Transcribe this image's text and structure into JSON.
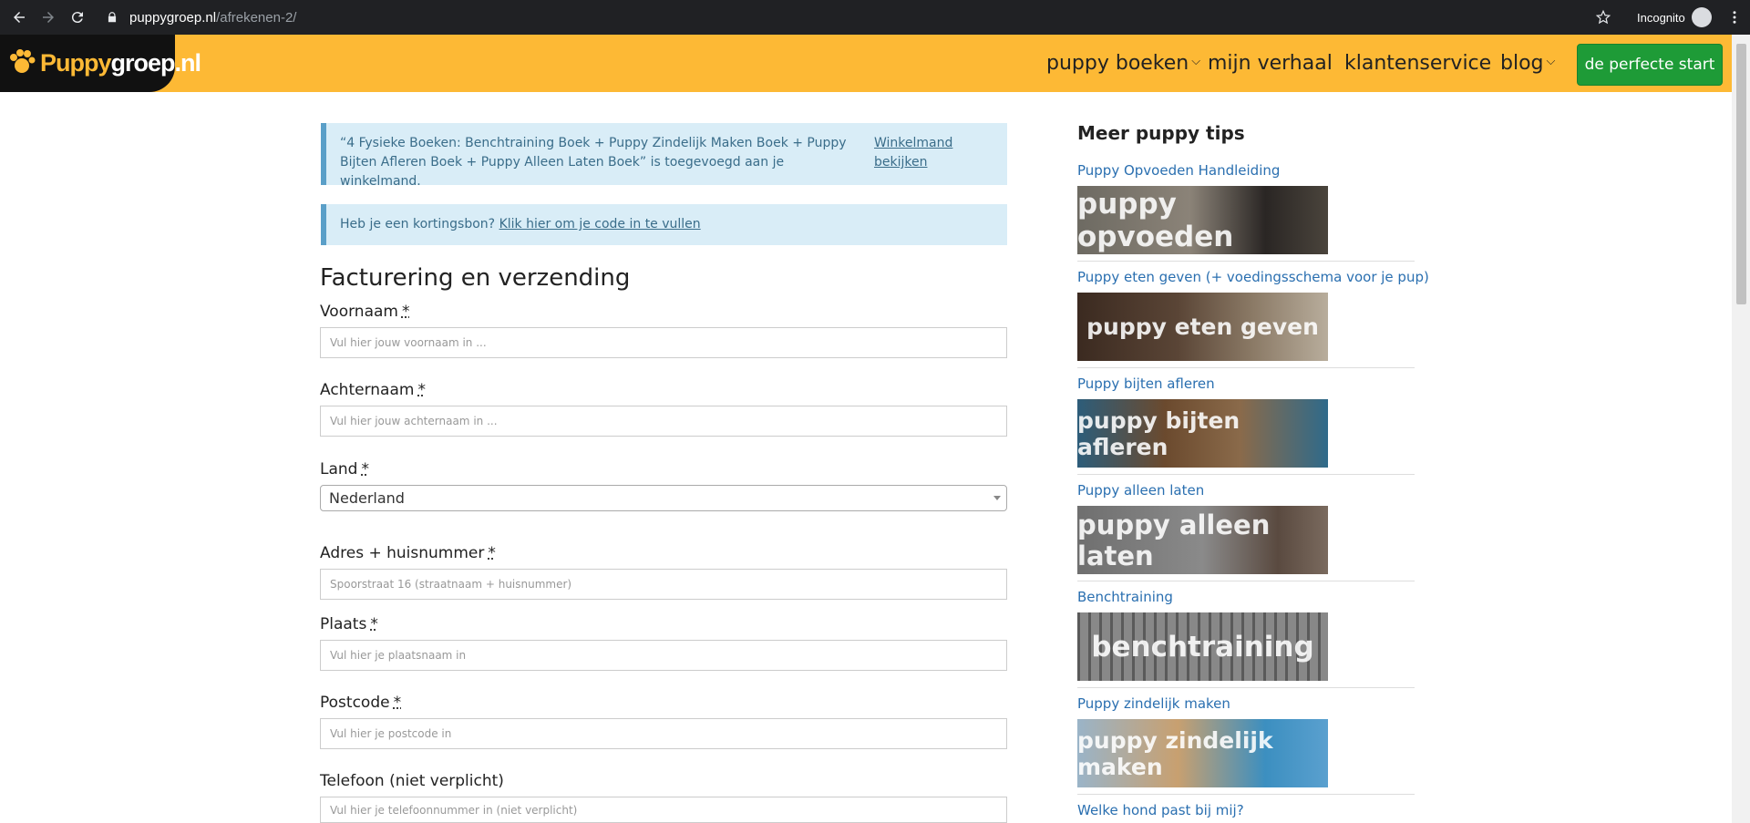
{
  "browser": {
    "url_host": "puppygroep.nl",
    "url_path": "/afrekenen-2/",
    "incognito_label": "Incognito"
  },
  "header": {
    "logo_part1": "Puppy",
    "logo_part2": "groep.nl",
    "nav": [
      "puppy boeken",
      "mijn verhaal",
      "klantenservice",
      "blog"
    ],
    "cta": "de perfecte start"
  },
  "notices": {
    "cart_message": "“4 Fysieke Boeken: Benchtraining Boek + Puppy Zindelijk Maken Boek + Puppy Bijten Afleren Boek + Puppy Alleen Laten Boek” is toegevoegd aan je winkelmand.",
    "cart_link": "Winkelmand bekijken",
    "coupon_text": "Heb je een kortingsbon?",
    "coupon_link": "Klik hier om je code in te vullen"
  },
  "form": {
    "title": "Facturering en verzending",
    "required_mark": "*",
    "fields": {
      "voornaam": {
        "label": "Voornaam",
        "placeholder": "Vul hier jouw voornaam in ..."
      },
      "achternaam": {
        "label": "Achternaam",
        "placeholder": "Vul hier jouw achternaam in ..."
      },
      "land": {
        "label": "Land",
        "value": "Nederland"
      },
      "adres": {
        "label": "Adres + huisnummer",
        "placeholder": "Spoorstraat 16 (straatnaam + huisnummer)"
      },
      "plaats": {
        "label": "Plaats",
        "placeholder": "Vul hier je plaatsnaam in"
      },
      "postcode": {
        "label": "Postcode",
        "placeholder": "Vul hier je postcode in"
      },
      "telefoon": {
        "label": "Telefoon (niet verplicht)",
        "placeholder": "Vul hier je telefoonnummer in (niet verplicht)"
      }
    }
  },
  "sidebar": {
    "title": "Meer puppy tips",
    "items": [
      {
        "link": "Puppy Opvoeden Handleiding",
        "image_text": "puppy opvoeden"
      },
      {
        "link": "Puppy eten geven (+ voedingsschema voor je pup)",
        "image_text": "puppy eten geven"
      },
      {
        "link": "Puppy bijten afleren",
        "image_text": "puppy bijten afleren"
      },
      {
        "link": "Puppy alleen laten",
        "image_text": "puppy alleen laten"
      },
      {
        "link": "Benchtraining",
        "image_text": "benchtraining"
      },
      {
        "link": "Puppy zindelijk maken",
        "image_text": "puppy zindelijk maken"
      },
      {
        "link": "Welke hond past bij mij?"
      }
    ]
  },
  "colors": {
    "brand_yellow": "#fdb935",
    "cta_green": "#1e9b37",
    "notice_bg": "#d9edf7",
    "link_blue": "#2a6fb0"
  }
}
